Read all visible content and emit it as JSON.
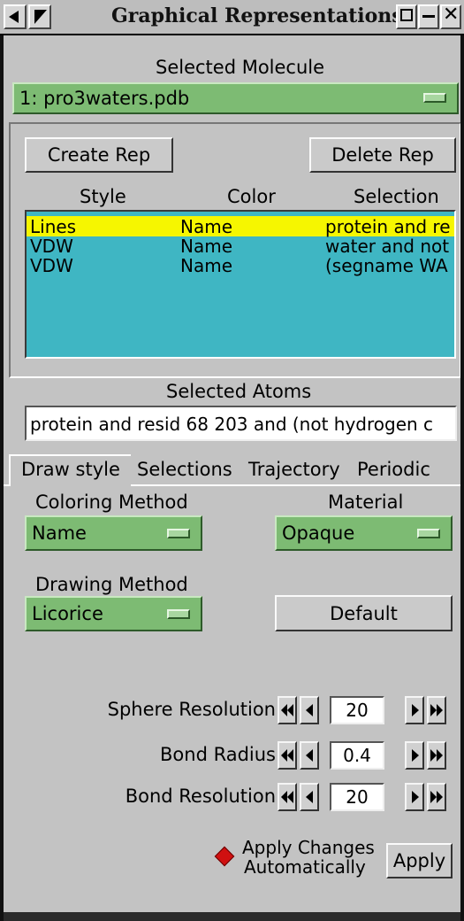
{
  "window": {
    "title": "Graphical Representations"
  },
  "selected_molecule": {
    "label": "Selected Molecule",
    "value": "1: pro3waters.pdb"
  },
  "toolbar": {
    "create_label": "Create Rep",
    "delete_label": "Delete Rep"
  },
  "reps_table": {
    "headers": {
      "style": "Style",
      "color": "Color",
      "selection": "Selection"
    },
    "rows": [
      {
        "style": "Lines",
        "color": "Name",
        "selection": "protein and re"
      },
      {
        "style": "VDW",
        "color": "Name",
        "selection": "water and not"
      },
      {
        "style": "VDW",
        "color": "Name",
        "selection": "(segname WA"
      }
    ]
  },
  "selected_atoms": {
    "label": "Selected Atoms",
    "value": "protein and resid 68 203 and (not hydrogen c"
  },
  "tabs": [
    {
      "label": "Draw style"
    },
    {
      "label": "Selections"
    },
    {
      "label": "Trajectory"
    },
    {
      "label": "Periodic"
    }
  ],
  "draw_style": {
    "coloring_label": "Coloring Method",
    "coloring_value": "Name",
    "material_label": "Material",
    "material_value": "Opaque",
    "drawing_label": "Drawing Method",
    "drawing_value": "Licorice",
    "default_label": "Default",
    "sphere_resolution_label": "Sphere Resolution",
    "sphere_resolution_value": "20",
    "bond_radius_label": "Bond Radius",
    "bond_radius_value": "0.4",
    "bond_resolution_label": "Bond Resolution",
    "bond_resolution_value": "20",
    "apply_auto_line1": "Apply Changes",
    "apply_auto_line2": "Automatically",
    "apply_label": "Apply"
  },
  "colors": {
    "menu_green": "#7dbb73",
    "list_cyan": "#3fb6c3",
    "selection_yellow": "#f6f600",
    "toggle_red": "#d01010"
  }
}
